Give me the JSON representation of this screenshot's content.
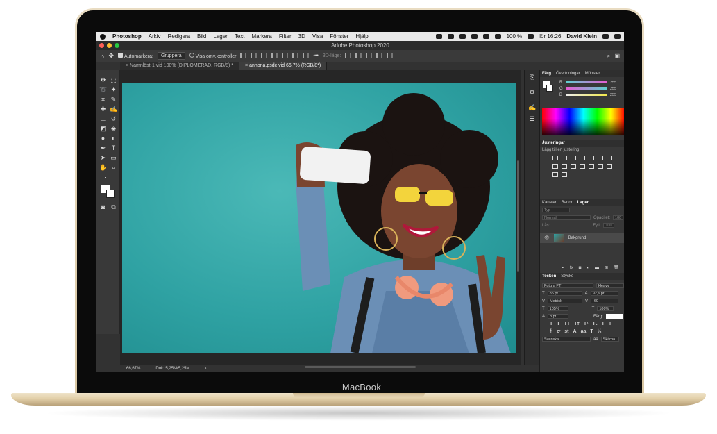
{
  "device": {
    "brand": "MacBook"
  },
  "menubar": {
    "app_name": "Photoshop",
    "items": [
      "Arkiv",
      "Redigera",
      "Bild",
      "Lager",
      "Text",
      "Markera",
      "Filter",
      "3D",
      "Visa",
      "Fönster",
      "Hjälp"
    ],
    "battery": "100 %",
    "clock": "lör 16:26",
    "user": "David Klein"
  },
  "window": {
    "title": "Adobe Photoshop 2020"
  },
  "options_bar": {
    "auto_select_label": "Automarkera:",
    "auto_select_value": "Gruppera",
    "show_transform_label": "Visa omv.kontroller",
    "mode_3d_label": "3D-läge:"
  },
  "tabs": [
    {
      "label": "Namnlöst-1 vid 100% (DIPLOMERAD, RGB/8) *"
    },
    {
      "label": "annona.psdc vid 66,7% (RGB/8*)"
    }
  ],
  "status": {
    "zoom": "66,67%",
    "doc": "Dok: 5,25M/5,25M"
  },
  "panels": {
    "color_tabs": [
      "Färg",
      "Övertoningar",
      "Mönster"
    ],
    "color_values": [
      {
        "channel": "R",
        "value": "255"
      },
      {
        "channel": "G",
        "value": "255"
      },
      {
        "channel": "B",
        "value": "255"
      }
    ],
    "adjustments": {
      "title": "Justeringar",
      "subtitle": "Lägg till en justering"
    },
    "layers_tabs": [
      "Kanaler",
      "Banor",
      "Lager"
    ],
    "layers": {
      "filter_placeholder": "Typ",
      "blend_mode": "Normal",
      "opacity_label": "Opacitet:",
      "opacity_value": "100",
      "lock_label": "Lås:",
      "fill_label": "Fyll:",
      "fill_value": "100",
      "layer_name": "Bakgrund"
    },
    "character_tabs": [
      "Tecken",
      "Stycke"
    ],
    "character": {
      "font_family": "Futura PT",
      "font_style": "Heavy",
      "font_size": "85 pt",
      "leading": "92,6 pt",
      "kerning": "Metrisk",
      "tracking": "-60",
      "vertical_scale": "105%",
      "horizontal_scale": "100%",
      "baseline": "8 pt",
      "color_label": "Färg:",
      "language": "Svenska",
      "antialias": "Skärpa"
    }
  },
  "colors": {
    "background_swatch": "#ffffff",
    "r_bar": "#e85bd3",
    "g_bar": "#5cd3d0",
    "b_bar": "#f0e64a"
  }
}
